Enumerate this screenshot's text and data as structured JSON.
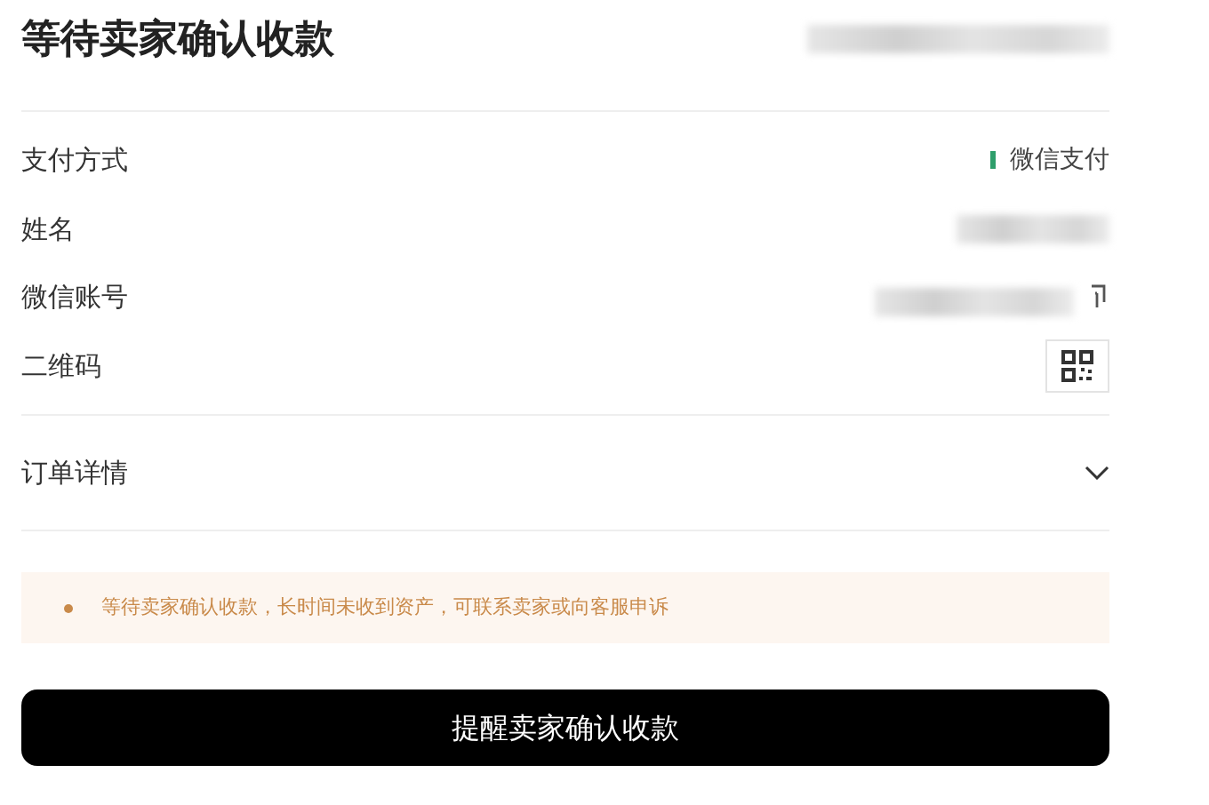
{
  "title": "等待卖家确认收款",
  "rows": [
    {
      "label": "支付方式",
      "kind": "method",
      "value": "微信支付"
    },
    {
      "label": "姓名",
      "kind": "hidden"
    },
    {
      "label": "微信账号",
      "kind": "account"
    },
    {
      "label": "二维码",
      "kind": "qr"
    }
  ],
  "order_details": {
    "label": "订单详情",
    "expanded": false
  },
  "notice": "等待卖家确认收款，长时间未收到资产，可联系卖家或向客服申诉",
  "button": "提醒卖家确认收款"
}
